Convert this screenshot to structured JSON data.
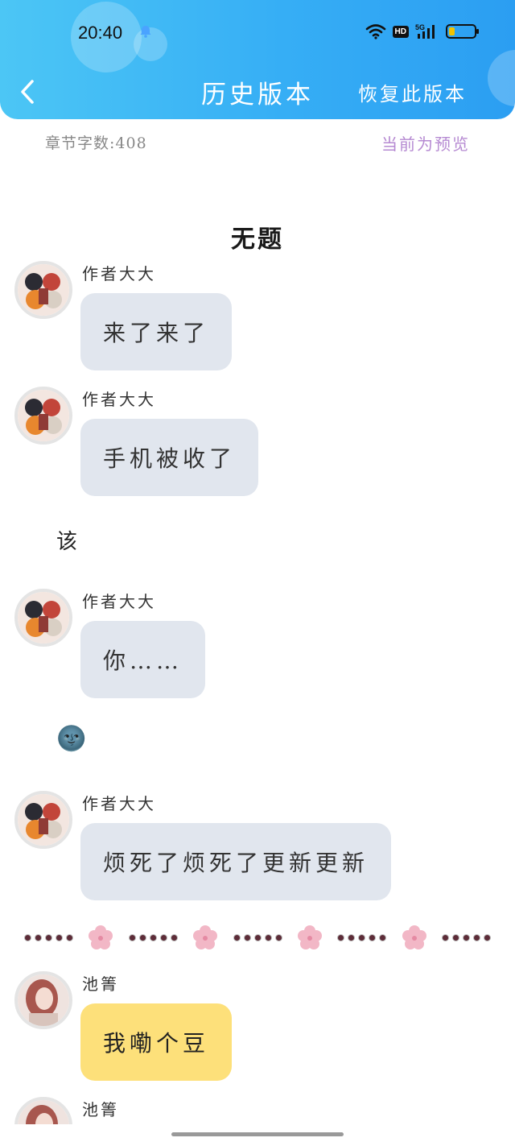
{
  "status_bar": {
    "time": "20:40",
    "hd": "HD",
    "network": "5G"
  },
  "nav": {
    "title": "历史版本",
    "action": "恢复此版本"
  },
  "info": {
    "word_count": "章节字数:408",
    "preview": "当前为预览"
  },
  "chapter": {
    "title": "无题"
  },
  "messages": [
    {
      "sender": "作者大大",
      "text": "来了来了"
    },
    {
      "sender": "作者大大",
      "text": "手机被收了"
    },
    {
      "sender": "作者大大",
      "text": "你……"
    },
    {
      "sender": "作者大大",
      "text": "烦死了烦死了更新更新"
    },
    {
      "sender": "池箐",
      "text": "我嘞个豆"
    },
    {
      "sender": "池箐"
    }
  ],
  "narration": {
    "line1": "该",
    "emoji": "🌚"
  },
  "colors": {
    "header_gradient_start": "#4cc6f5",
    "header_gradient_end": "#2b9ef2",
    "author_bubble": "#e1e6ee",
    "reader_bubble": "#fde07a",
    "preview_text": "#b68ad2"
  }
}
